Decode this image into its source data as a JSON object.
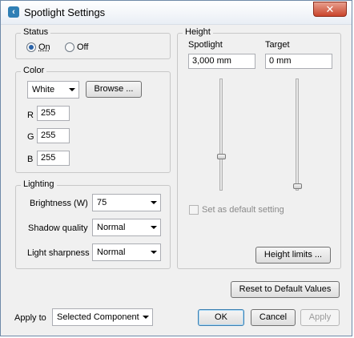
{
  "window": {
    "title": "Spotlight Settings",
    "close_glyph": "✕"
  },
  "status": {
    "legend": "Status",
    "options": [
      {
        "label": "On",
        "checked": true
      },
      {
        "label": "Off",
        "checked": false
      }
    ]
  },
  "color": {
    "legend": "Color",
    "selected": "White",
    "browse_label": "Browse ...",
    "r": {
      "label": "R",
      "value": "255"
    },
    "g": {
      "label": "G",
      "value": "255"
    },
    "b": {
      "label": "B",
      "value": "255"
    }
  },
  "lighting": {
    "legend": "Lighting",
    "brightness": {
      "label": "Brightness (W)",
      "value": "75"
    },
    "shadow_quality": {
      "label": "Shadow quality",
      "value": "Normal"
    },
    "light_sharpness": {
      "label": "Light sharpness",
      "value": "Normal"
    }
  },
  "height": {
    "legend": "Height",
    "spotlight": {
      "label": "Spotlight",
      "value": "3,000 mm",
      "slider_level": 0.28
    },
    "target": {
      "label": "Target",
      "value": "0 mm",
      "slider_level": 0.0
    },
    "default_setting_label": "Set as default setting",
    "limits_label": "Height limits ..."
  },
  "reset_label": "Reset to Default Values",
  "apply_to": {
    "label": "Apply to",
    "value": "Selected Component"
  },
  "buttons": {
    "ok": "OK",
    "cancel": "Cancel",
    "apply": "Apply"
  },
  "icons": {
    "app": "spotlight-app-icon"
  }
}
